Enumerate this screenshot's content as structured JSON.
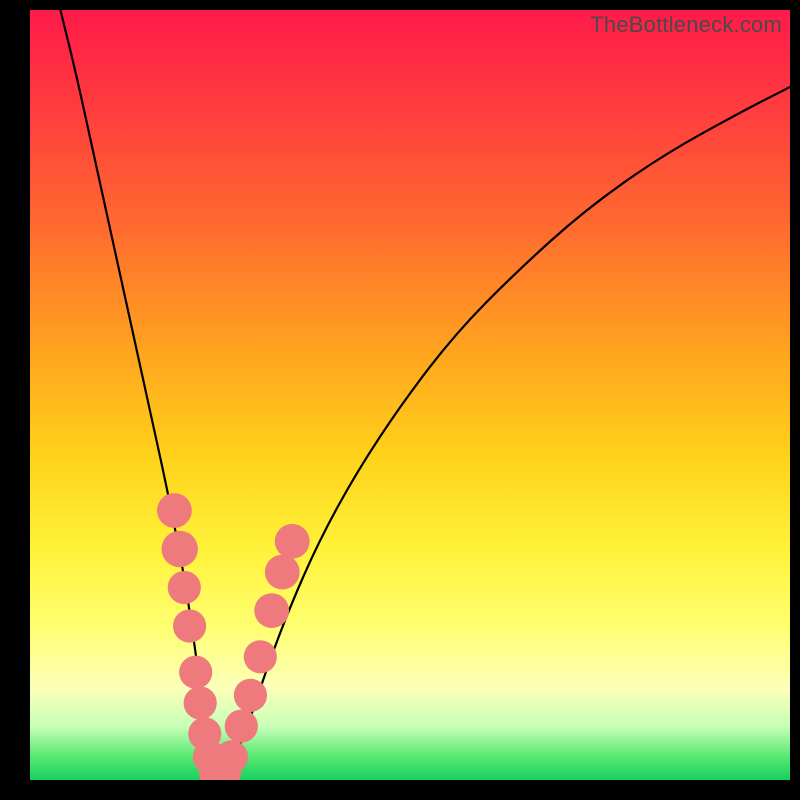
{
  "watermark": "TheBottleneck.com",
  "chart_data": {
    "type": "line",
    "title": "",
    "xlabel": "",
    "ylabel": "",
    "xlim": [
      0,
      100
    ],
    "ylim": [
      0,
      100
    ],
    "series": [
      {
        "name": "bottleneck-curve",
        "x": [
          4,
          6,
          8,
          10,
          12,
          14,
          16,
          18,
          20,
          21,
          22,
          23,
          23.7,
          24.5,
          25.5,
          27,
          29,
          31,
          34,
          38,
          43,
          49,
          56,
          64,
          73,
          83,
          94,
          100
        ],
        "y": [
          100,
          92,
          83,
          74,
          65,
          56,
          47,
          38,
          28,
          22,
          15,
          8,
          3,
          0.5,
          0.5,
          3,
          8,
          14,
          22,
          31,
          40,
          49,
          58,
          66,
          74,
          81,
          87,
          90
        ]
      }
    ],
    "markers": {
      "name": "highlight-beads",
      "points": [
        {
          "x": 19.0,
          "y": 35,
          "r": 1.5
        },
        {
          "x": 19.7,
          "y": 30,
          "r": 1.6
        },
        {
          "x": 20.3,
          "y": 25,
          "r": 1.4
        },
        {
          "x": 21.0,
          "y": 20,
          "r": 1.4
        },
        {
          "x": 21.8,
          "y": 14,
          "r": 1.4
        },
        {
          "x": 22.4,
          "y": 10,
          "r": 1.4
        },
        {
          "x": 23.0,
          "y": 6,
          "r": 1.4
        },
        {
          "x": 23.6,
          "y": 3,
          "r": 1.4
        },
        {
          "x": 24.5,
          "y": 1,
          "r": 1.5
        },
        {
          "x": 25.5,
          "y": 1,
          "r": 1.5
        },
        {
          "x": 26.5,
          "y": 3,
          "r": 1.4
        },
        {
          "x": 27.8,
          "y": 7,
          "r": 1.4
        },
        {
          "x": 29.0,
          "y": 11,
          "r": 1.4
        },
        {
          "x": 30.3,
          "y": 16,
          "r": 1.4
        },
        {
          "x": 31.8,
          "y": 22,
          "r": 1.5
        },
        {
          "x": 33.2,
          "y": 27,
          "r": 1.5
        },
        {
          "x": 34.5,
          "y": 31,
          "r": 1.5
        }
      ]
    }
  }
}
